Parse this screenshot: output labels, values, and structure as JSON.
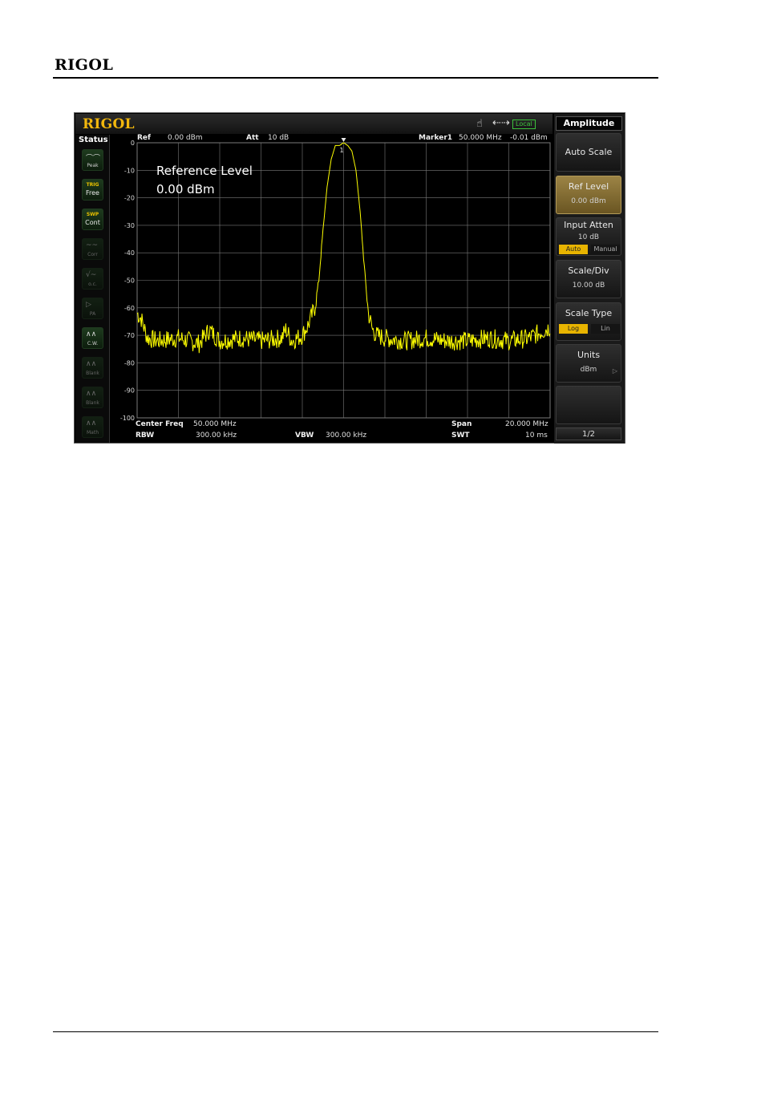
{
  "doc": {
    "header": "RIGOL"
  },
  "screen": {
    "logo": "RIGOL",
    "indicators": {
      "local": "Local",
      "hand_icon": "hand-icon",
      "usb_icon": "usb-icon"
    },
    "status": {
      "title": "Status",
      "buttons": [
        {
          "top": "",
          "bottom": "Peak"
        },
        {
          "top": "TRIG",
          "bottom": "Free"
        },
        {
          "top": "SWP",
          "bottom": "Cont"
        },
        {
          "top": "",
          "bottom": "Corr"
        },
        {
          "top": "",
          "bottom": "o.c."
        },
        {
          "top": "",
          "bottom": "PA"
        },
        {
          "top": "",
          "bottom": "C.W."
        },
        {
          "top": "",
          "bottom": "Blank"
        },
        {
          "top": "",
          "bottom": "Blank"
        },
        {
          "top": "",
          "bottom": "Math"
        }
      ]
    },
    "top_info": {
      "ref_label": "Ref",
      "ref_value": "0.00 dBm",
      "att_label": "Att",
      "att_value": "10 dB",
      "marker_label": "Marker1",
      "marker_freq": "50.000 MHz",
      "marker_amp": "-0.01 dBm"
    },
    "bottom_info": {
      "center_label": "Center Freq",
      "center_value": "50.000 MHz",
      "span_label": "Span",
      "span_value": "20.000 MHz",
      "rbw_label": "RBW",
      "rbw_value": "300.00 kHz",
      "vbw_label": "VBW",
      "vbw_value": "300.00 kHz",
      "swt_label": "SWT",
      "swt_value": "10 ms"
    },
    "ref_overlay": {
      "line1": "Reference Level",
      "line2": "0.00 dBm"
    },
    "marker_number": "1",
    "softmenu": {
      "title": "Amplitude",
      "auto_scale": "Auto Scale",
      "ref_level": {
        "name": "Ref Level",
        "value": "0.00 dBm"
      },
      "input_atten": {
        "name": "Input Atten",
        "value": "10 dB",
        "opt_auto": "Auto",
        "opt_manual": "Manual",
        "selected": "Auto"
      },
      "scale_div": {
        "name": "Scale/Div",
        "value": "10.00 dB"
      },
      "scale_type": {
        "name": "Scale Type",
        "opt_log": "Log",
        "opt_lin": "Lin",
        "selected": "Log"
      },
      "units": {
        "name": "Units",
        "value": "dBm"
      },
      "page": "1/2"
    },
    "colors": {
      "trace": "#ffff00",
      "accent": "#e8b400",
      "grid": "#7a7a7a"
    }
  },
  "chart_data": {
    "type": "line",
    "xlabel": "",
    "ylabel": "",
    "y_ticks": [
      "0",
      "-10",
      "-20",
      "-30",
      "-40",
      "-50",
      "-60",
      "-70",
      "-80",
      "-90",
      "-100"
    ],
    "ylim": [
      -100,
      0
    ],
    "xlim": [
      40,
      60
    ],
    "grid": true,
    "series": [
      {
        "x": [
          40,
          40.2,
          40.5,
          41,
          42,
          43,
          43.5,
          44,
          45,
          46,
          47,
          47.2,
          47.5,
          48,
          48.3,
          48.6,
          48.8,
          49,
          49.2,
          49.4,
          49.6,
          49.8,
          50,
          50.2,
          50.4,
          50.6,
          50.8,
          51,
          51.2,
          51.4,
          51.6,
          52,
          53,
          54,
          55,
          56,
          57,
          58,
          59,
          59.5,
          60
        ],
        "y": [
          -62,
          -64,
          -71,
          -72,
          -71,
          -73,
          -68,
          -72,
          -71,
          -72,
          -71,
          -68,
          -72,
          -70,
          -66,
          -60,
          -50,
          -32,
          -16,
          -6,
          -1,
          -1,
          0,
          -1,
          -3,
          -10,
          -25,
          -45,
          -62,
          -68,
          -70,
          -71,
          -72,
          -71,
          -72,
          -72,
          -71,
          -72,
          -71,
          -69,
          -67
        ]
      }
    ],
    "marker": {
      "x": 50,
      "y": -0.01,
      "label": "1"
    }
  }
}
